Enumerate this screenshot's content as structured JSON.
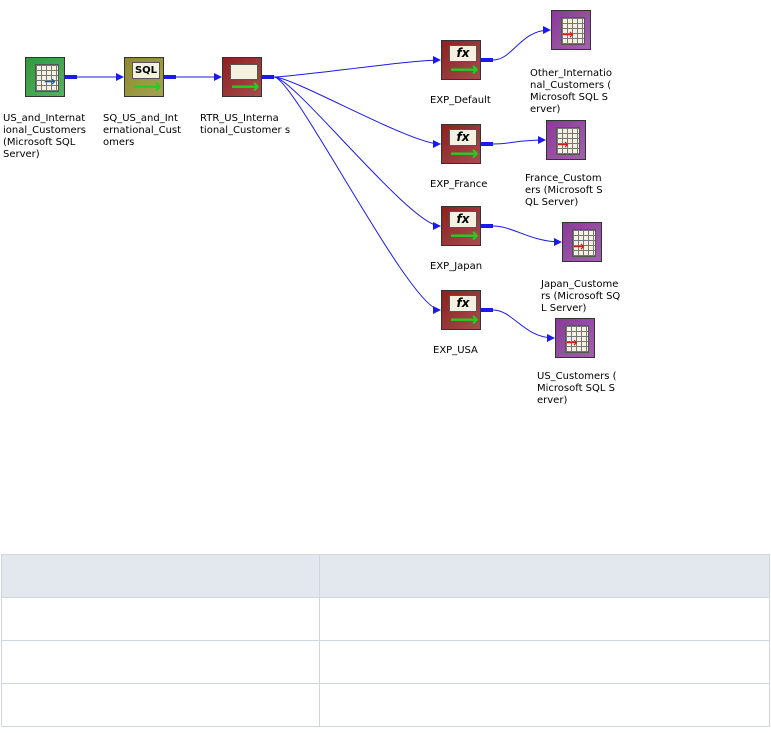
{
  "diagram": {
    "nodes": [
      {
        "id": "src",
        "kind": "source",
        "label_lines": [
          "US_and_Internat",
          "ional_Customers",
          "(Microsoft SQL",
          "Server)"
        ]
      },
      {
        "id": "sq",
        "kind": "source_qualifier",
        "icon_text": "SQL",
        "label_lines": [
          "SQ_US_and_Int",
          "ernational_Cust",
          "omers"
        ]
      },
      {
        "id": "rtr",
        "kind": "router",
        "label_lines": [
          "RTR_US_Interna",
          "tional_Customer s"
        ]
      },
      {
        "id": "exp_default",
        "kind": "expression",
        "icon_text": "fx",
        "label_lines": [
          "EXP_Default"
        ]
      },
      {
        "id": "exp_france",
        "kind": "expression",
        "icon_text": "fx",
        "label_lines": [
          "EXP_France"
        ]
      },
      {
        "id": "exp_japan",
        "kind": "expression",
        "icon_text": "fx",
        "label_lines": [
          "EXP_Japan"
        ]
      },
      {
        "id": "exp_usa",
        "kind": "expression",
        "icon_text": "fx",
        "label_lines": [
          "EXP_USA"
        ]
      },
      {
        "id": "tgt_other",
        "kind": "target",
        "label_lines": [
          "Other_Internatio",
          "nal_Customers (",
          "Microsoft SQL S",
          "erver)"
        ]
      },
      {
        "id": "tgt_france",
        "kind": "target",
        "label_lines": [
          "France_Custom",
          "ers (Microsoft S",
          "QL Server)"
        ]
      },
      {
        "id": "tgt_japan",
        "kind": "target",
        "label_lines": [
          "Japan_Custome",
          "rs (Microsoft SQ",
          "L Server)"
        ]
      },
      {
        "id": "tgt_us",
        "kind": "target",
        "label_lines": [
          "US_Customers (",
          "Microsoft SQL S",
          "erver)"
        ]
      }
    ],
    "edges": [
      {
        "from": "src",
        "to": "sq"
      },
      {
        "from": "sq",
        "to": "rtr"
      },
      {
        "from": "rtr",
        "to": "exp_default"
      },
      {
        "from": "rtr",
        "to": "exp_france"
      },
      {
        "from": "rtr",
        "to": "exp_japan"
      },
      {
        "from": "rtr",
        "to": "exp_usa"
      },
      {
        "from": "exp_default",
        "to": "tgt_other"
      },
      {
        "from": "exp_france",
        "to": "tgt_france"
      },
      {
        "from": "exp_japan",
        "to": "tgt_japan"
      },
      {
        "from": "exp_usa",
        "to": "tgt_us"
      }
    ],
    "colors": {
      "source": "#2f9b3a",
      "source_qualifier": "#8e8a2a",
      "router": "#8e2020",
      "expression": "#8e2020",
      "target": "#8a3a98",
      "edge": "#1a1aee"
    }
  },
  "table": {
    "header": [
      "",
      ""
    ],
    "rows": [
      [
        "",
        ""
      ],
      [
        "",
        ""
      ],
      [
        "",
        ""
      ]
    ]
  }
}
